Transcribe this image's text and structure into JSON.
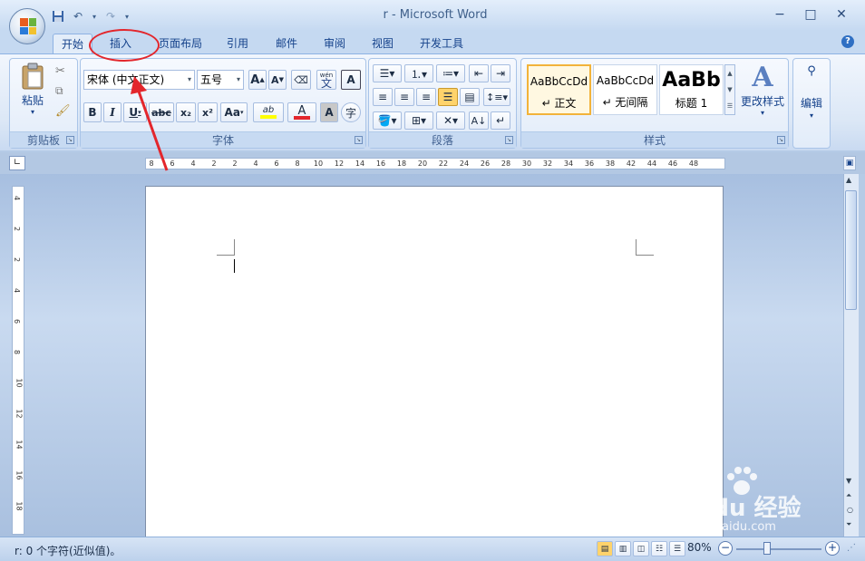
{
  "window": {
    "title": "r - Microsoft Word",
    "minimize": "−",
    "maximize": "□",
    "close": "✕"
  },
  "tabs": [
    {
      "label": "开始"
    },
    {
      "label": "插入"
    },
    {
      "label": "页面布局"
    },
    {
      "label": "引用"
    },
    {
      "label": "邮件"
    },
    {
      "label": "审阅"
    },
    {
      "label": "视图"
    },
    {
      "label": "开发工具"
    }
  ],
  "help": "?",
  "clipboard": {
    "group_label": "剪贴板",
    "paste_label": "粘贴"
  },
  "font": {
    "group_label": "字体",
    "font_name": "宋体 (中文正文)",
    "font_size": "五号",
    "grow": "A",
    "shrink": "A",
    "phonetic": "wén",
    "phonetic_char": "文",
    "border_char": "A",
    "bold": "B",
    "italic": "I",
    "underline": "U",
    "strike": "abc",
    "subscript": "x₂",
    "superscript": "x²",
    "change_case": "Aa",
    "highlight": "ab",
    "font_color": "A",
    "shading": "A",
    "enclose": "字"
  },
  "paragraph": {
    "group_label": "段落"
  },
  "styles": {
    "group_label": "样式",
    "items": [
      {
        "sample": "AaBbCcDd",
        "name": "↵ 正文"
      },
      {
        "sample": "AaBbCcDd",
        "name": "↵ 无间隔"
      },
      {
        "sample": "AaBb",
        "name": "标题 1"
      }
    ],
    "change_label": "更改样式"
  },
  "editing": {
    "label": "编辑"
  },
  "ruler": {
    "h_ticks": [
      "8",
      "6",
      "4",
      "2",
      "2",
      "4",
      "6",
      "8",
      "10",
      "12",
      "14",
      "16",
      "18",
      "20",
      "22",
      "24",
      "26",
      "28",
      "30",
      "32",
      "34",
      "36",
      "38",
      "42",
      "44",
      "46",
      "48"
    ],
    "v_ticks": [
      "4",
      "2",
      "2",
      "4",
      "6",
      "8",
      "10",
      "12",
      "14",
      "16",
      "18"
    ]
  },
  "status": {
    "text": "r: 0 个字符(近似值)。",
    "zoom": "80%"
  },
  "watermark": {
    "brand": "Bai du 经验",
    "url": "jingyan.baidu.com"
  },
  "colors": {
    "accent": "#15428b",
    "annotation": "#e3262c",
    "highlight": "#ffff00",
    "font_color": "#e3262c"
  }
}
